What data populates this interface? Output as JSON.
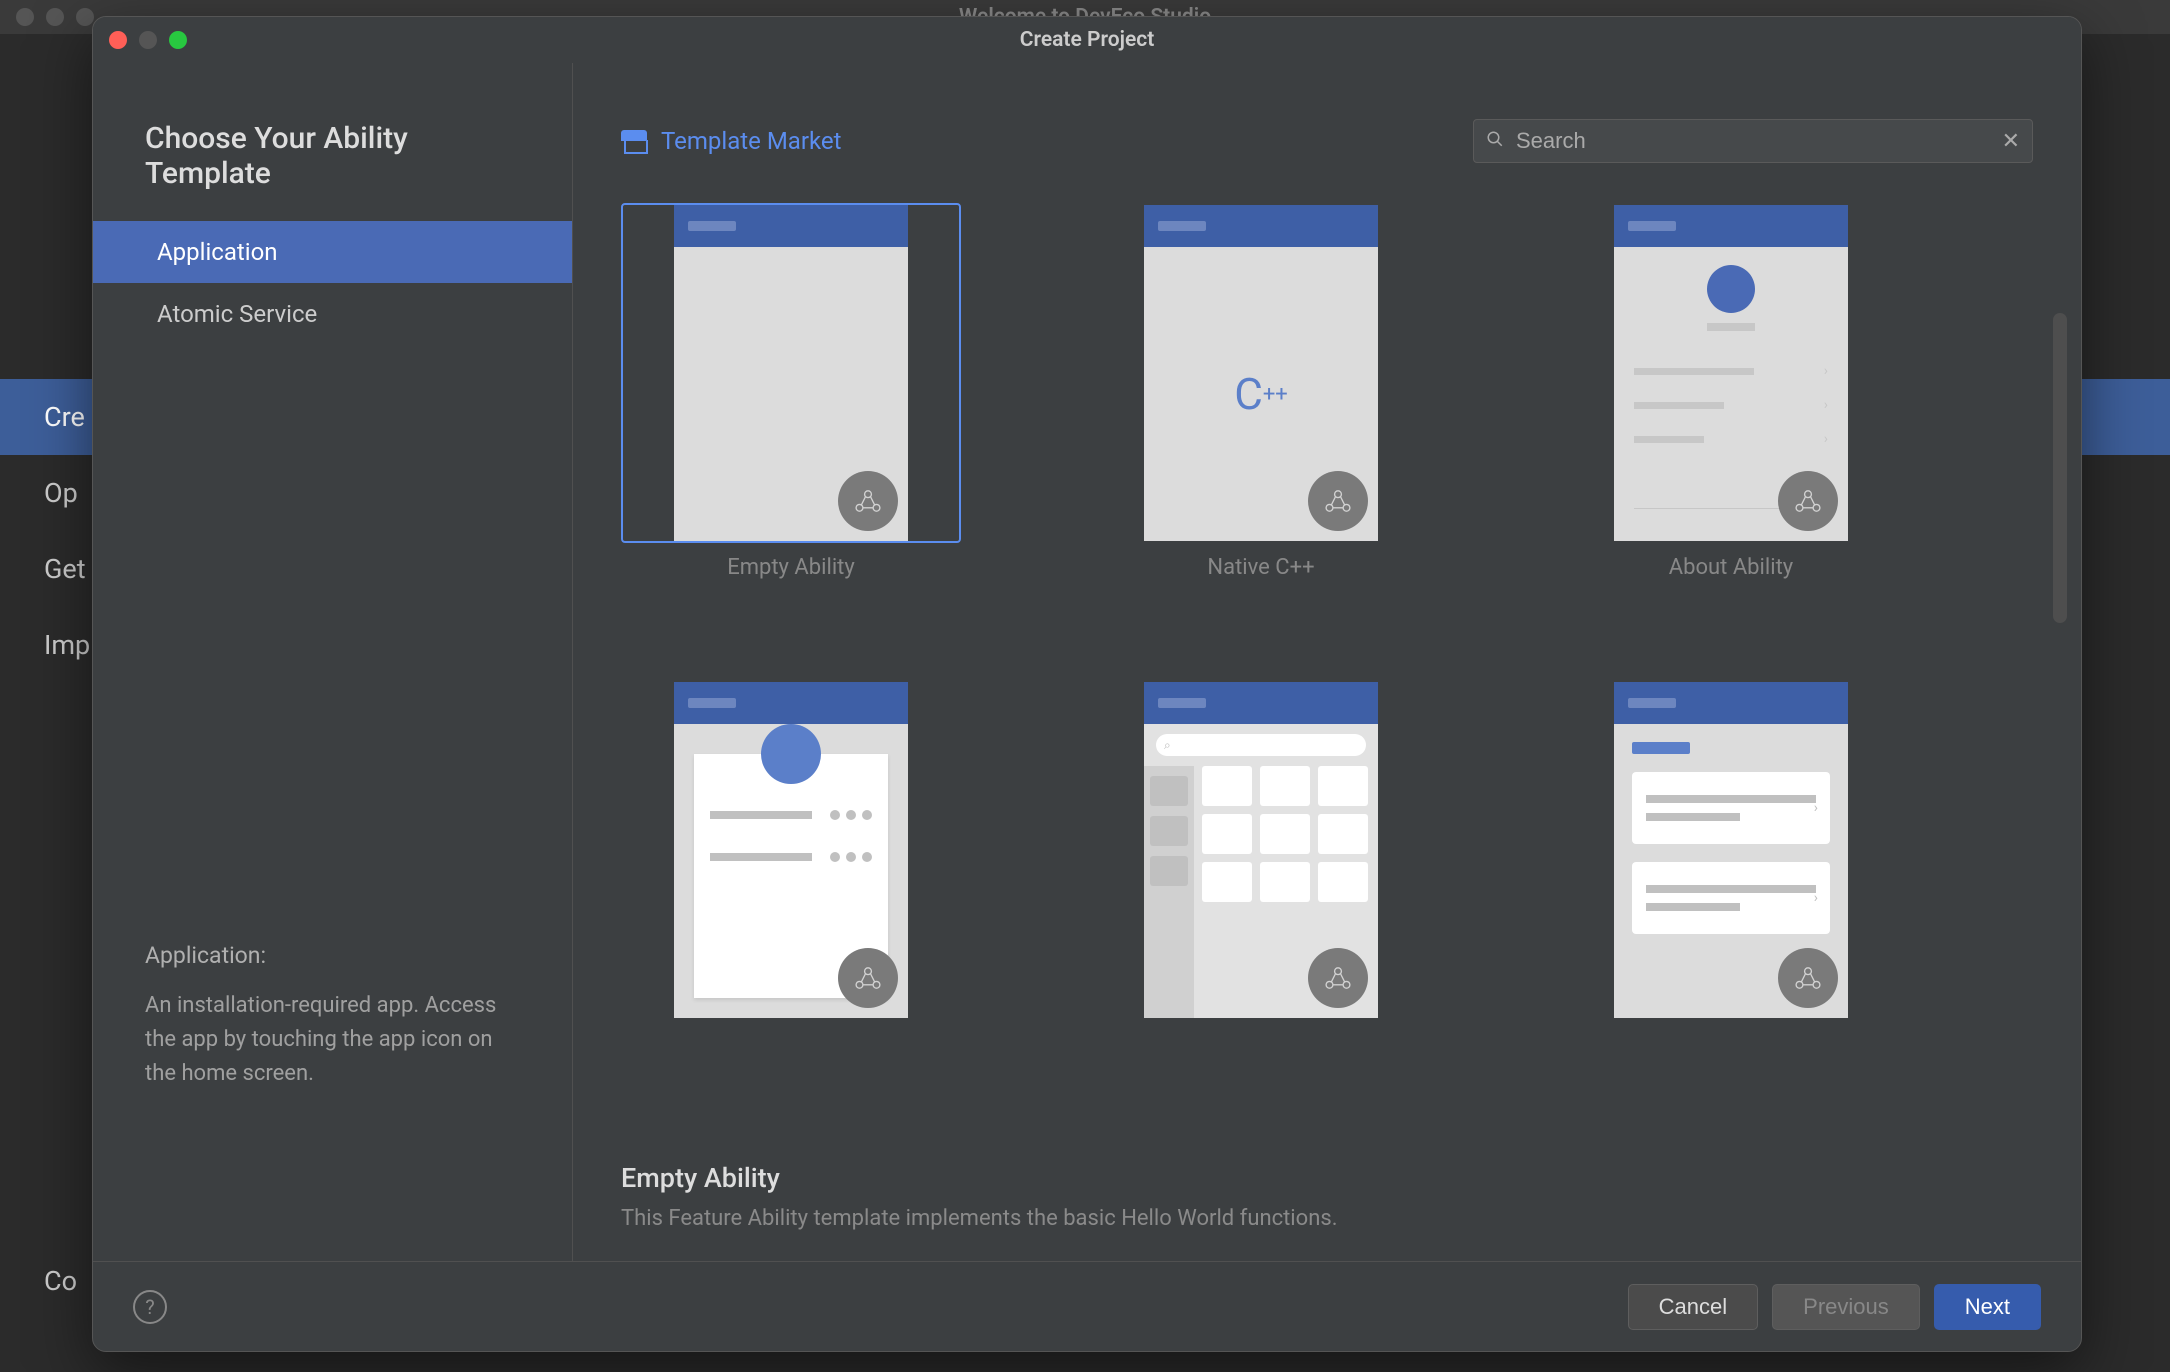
{
  "background": {
    "title": "Welcome to DevEco Studio",
    "nav": [
      "Cre",
      "Op",
      "Get",
      "Imp",
      "Co"
    ],
    "selected_index": 0
  },
  "dialog": {
    "title": "Create Project",
    "heading": "Choose Your Ability Template",
    "sidebar": {
      "items": [
        {
          "label": "Application",
          "selected": true
        },
        {
          "label": "Atomic Service",
          "selected": false
        }
      ],
      "desc_title": "Application:",
      "desc_body": "An installation-required app. Access the app by touching the app icon on the home screen."
    },
    "market_link": "Template Market",
    "search": {
      "placeholder": "Search",
      "value": ""
    },
    "templates": [
      {
        "label": "Empty Ability",
        "thumb": "empty",
        "selected": true
      },
      {
        "label": "Native C++",
        "thumb": "cpp",
        "selected": false
      },
      {
        "label": "About Ability",
        "thumb": "about",
        "selected": false
      },
      {
        "label": "",
        "thumb": "bizcard",
        "selected": false
      },
      {
        "label": "",
        "thumb": "category",
        "selected": false
      },
      {
        "label": "",
        "thumb": "listtab",
        "selected": false
      }
    ],
    "selection": {
      "title": "Empty Ability",
      "description": "This Feature Ability template implements the basic Hello World functions."
    },
    "footer": {
      "cancel": "Cancel",
      "previous": "Previous",
      "next": "Next"
    }
  }
}
